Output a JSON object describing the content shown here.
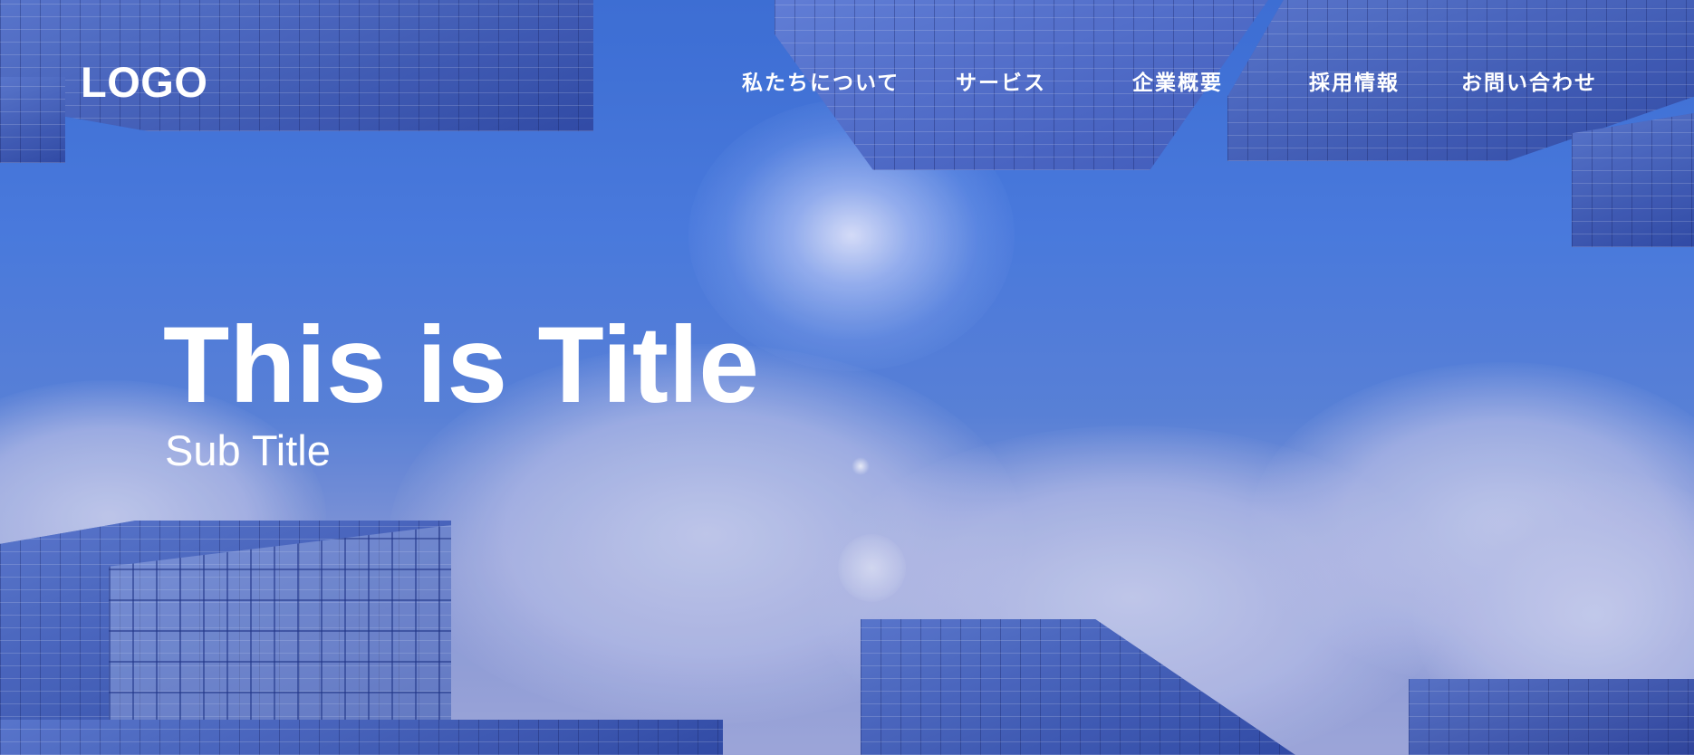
{
  "header": {
    "logo": "LOGO",
    "nav": [
      {
        "label": "私たちについて"
      },
      {
        "label": "サービス"
      },
      {
        "label": "企業概要"
      },
      {
        "label": "採用情報"
      },
      {
        "label": "お問い合わせ"
      }
    ]
  },
  "hero": {
    "title": "This is Title",
    "subtitle": "Sub Title",
    "background": "skyscrapers-looking-up-blue-sky"
  },
  "colors": {
    "text": "#ffffff",
    "sky": "#4c7ee0",
    "building": "#3550a8"
  }
}
